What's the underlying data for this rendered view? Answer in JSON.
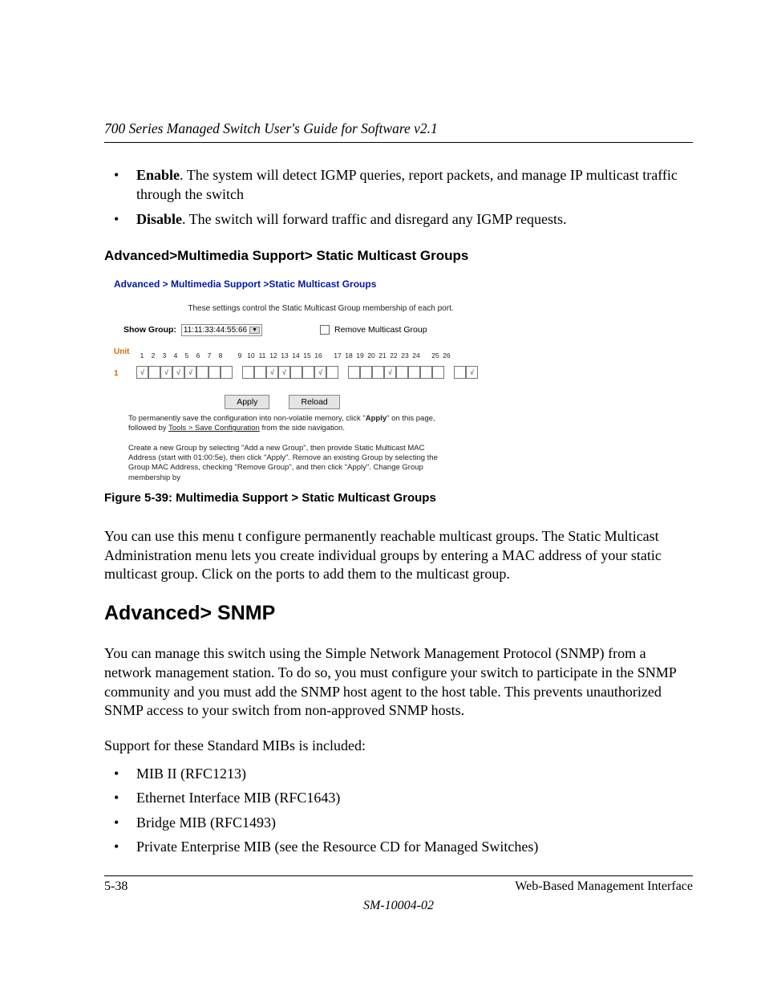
{
  "header": {
    "title": "700 Series Managed Switch User's Guide for Software v2.1"
  },
  "bullets_top": [
    {
      "term": "Enable",
      "rest": ". The system will detect IGMP queries, report packets, and manage IP multicast traffic through the switch"
    },
    {
      "term": "Disable",
      "rest": ". The switch will forward traffic and disregard any IGMP requests."
    }
  ],
  "section1": {
    "heading": "Advanced>Multimedia Support> Static Multicast Groups"
  },
  "figure": {
    "breadcrumb": "Advanced > Multimedia Support >Static Multicast Groups",
    "description": "These settings control the Static Multicast Group membership of each port.",
    "show_group_label": "Show Group:",
    "show_group_value": "11:11:33:44:55:66",
    "remove_label": "Remove Multicast Group",
    "unit_label": "Unit",
    "row_label": "1",
    "ports_headers": [
      "1",
      "2",
      "3",
      "4",
      "5",
      "6",
      "7",
      "8",
      "",
      "9",
      "10",
      "11",
      "12",
      "13",
      "14",
      "15",
      "16",
      "",
      "17",
      "18",
      "19",
      "20",
      "21",
      "22",
      "23",
      "24",
      "",
      "25",
      "26"
    ],
    "ports_values": [
      "√",
      "",
      "√",
      "√",
      "√",
      "",
      "",
      "",
      "",
      "",
      "",
      "√",
      "√",
      "",
      "",
      "√",
      "",
      "",
      "",
      "",
      "",
      "√",
      "",
      "",
      "",
      "",
      "",
      "",
      "√"
    ],
    "apply_label": "Apply",
    "reload_label": "Reload",
    "note1_a": "To permanently save the configuration into non-volatile memory, click \"",
    "note1_b": "Apply",
    "note1_c": "\" on this page, followed by ",
    "note1_d": "Tools > Save Configuration",
    "note1_e": " from the side navigation.",
    "note2": "Create a new Group by selecting \"Add a new Group\", then provide Static Multicast MAC Address (start with 01:00:5e), then click \"Apply\". Remove an existing Group by selecting the Group MAC Address, checking \"Remove Group\", and then click \"Apply\". Change Group membership by",
    "caption": "Figure 5-39:  Multimedia Support > Static Multicast Groups"
  },
  "para1": "You can use this menu t configure permanently reachable multicast groups. The Static Multicast Administration menu lets you create individual groups by entering a MAC address of your static multicast group.  Click on the ports to add them to the multicast group.",
  "h2": "Advanced> SNMP",
  "para2": "You can manage this switch using the Simple Network Management Protocol (SNMP) from a network management station. To do so, you must configure your switch to participate in the SNMP community and you must add the SNMP host agent to the host table.  This prevents unauthorized SNMP access to your switch from non-approved SNMP hosts.",
  "para3": "Support for these Standard MIBs is included:",
  "mibs": [
    "MIB II (RFC1213)",
    "Ethernet Interface MIB (RFC1643)",
    "Bridge MIB (RFC1493)",
    "Private Enterprise MIB (see the Resource CD for Managed Switches)"
  ],
  "footer": {
    "left": "5-38",
    "right": "Web-Based Management Interface",
    "docid": "SM-10004-02"
  }
}
